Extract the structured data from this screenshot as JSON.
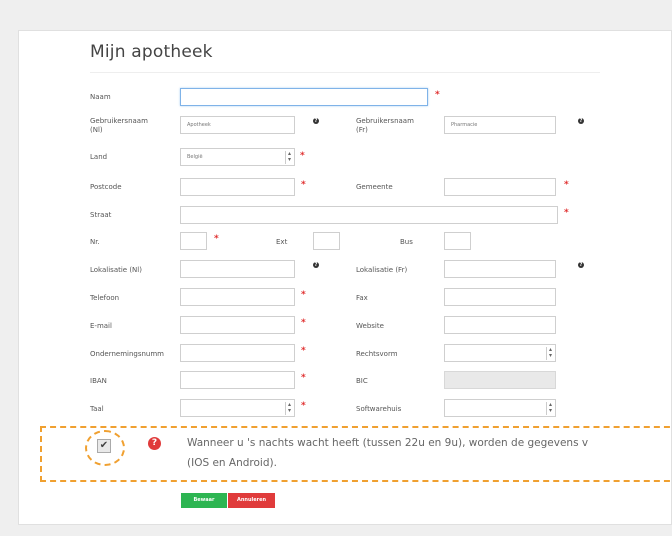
{
  "form": {
    "title": "Mijn apotheek",
    "labels": {
      "naam": "Naam",
      "gebruikersnaam_nl": "Gebruikersnaam (Nl)",
      "gebruikersnaam_fr": "Gebruikersnaam (Fr)",
      "land": "Land",
      "postcode": "Postcode",
      "gemeente": "Gemeente",
      "straat": "Straat",
      "nr": "Nr.",
      "ext": "Ext",
      "bus": "Bus",
      "lokalisatie_nl": "Lokalisatie (Nl)",
      "lokalisatie_fr": "Lokalisatie (Fr)",
      "telefoon": "Telefoon",
      "fax": "Fax",
      "email": "E-mail",
      "website": "Website",
      "ondernemingsnummer": "Ondernemingsnumm",
      "rechtsvorm": "Rechtsvorm",
      "iban": "IBAN",
      "bic": "BIC",
      "taal": "Taal",
      "softwarehuis": "Softwarehuis"
    },
    "values": {
      "gebruikersnaam_nl": "Apotheek",
      "gebruikersnaam_fr": "Pharmacie",
      "land": "België"
    },
    "required_mark": "*",
    "help_icon": "question-circle-icon"
  },
  "night_duty": {
    "checked": true,
    "note_line1": "Wanneer u 's nachts wacht heeft (tussen 22u en 9u), worden de gegevens v",
    "note_line2": "(IOS en Android)."
  },
  "buttons": {
    "save": "Bewaar",
    "cancel": "Annuleren"
  },
  "colors": {
    "required": "#e03030",
    "highlight": "#f0a030",
    "save_button": "#2db552",
    "cancel_button": "#e03b3b"
  }
}
